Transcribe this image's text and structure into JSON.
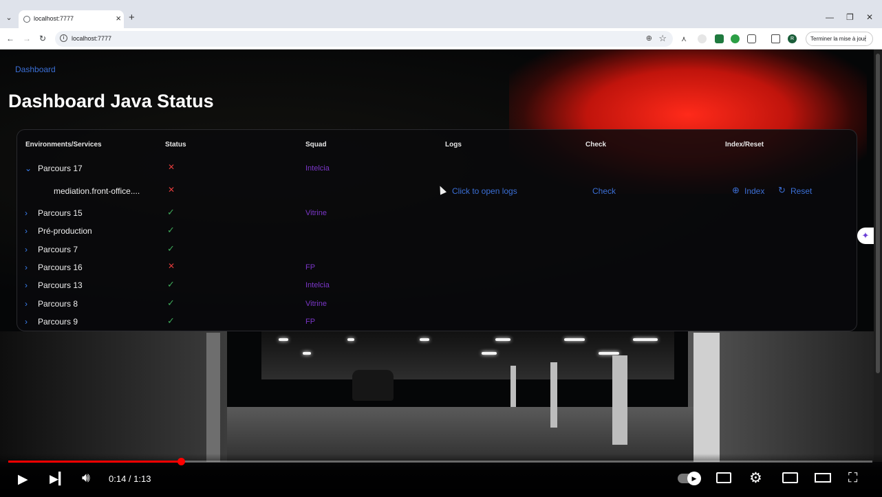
{
  "browser": {
    "tab_title": "localhost:7777",
    "url": "localhost:7777",
    "update_button_label": "Terminer la mise à jour",
    "profile_initial": "R"
  },
  "page": {
    "nav_link": "Dashboard",
    "title": "Dashboard Java Status"
  },
  "table": {
    "columns": [
      "Environments/Services",
      "Status",
      "Squad",
      "Logs",
      "Check",
      "Index/Reset"
    ],
    "rows": [
      {
        "name": "Parcours 17",
        "status": "error",
        "squad": "Intelcia",
        "expanded": true
      },
      {
        "name": "mediation.front-office....",
        "status": "error",
        "squad": "",
        "child": true,
        "logs_label": "Click to open logs",
        "check_label": "Check",
        "index_label": "Index",
        "reset_label": "Reset"
      },
      {
        "name": "Parcours 15",
        "status": "ok",
        "squad": "Vitrine"
      },
      {
        "name": "Pré-production",
        "status": "ok",
        "squad": ""
      },
      {
        "name": "Parcours 7",
        "status": "ok",
        "squad": ""
      },
      {
        "name": "Parcours 16",
        "status": "error",
        "squad": "FP"
      },
      {
        "name": "Parcours 13",
        "status": "ok",
        "squad": "Intelcia"
      },
      {
        "name": "Parcours 8",
        "status": "ok",
        "squad": "Vitrine"
      },
      {
        "name": "Parcours 9",
        "status": "ok",
        "squad": "FP"
      }
    ]
  },
  "video": {
    "time": "0:14 / 1:13",
    "progress": 0.2
  },
  "colors": {
    "status_ok": "#3faa5b",
    "status_error": "#e23b3b",
    "squad": "#7b36c9",
    "link": "#3b6fd6",
    "progress": "#ff0000"
  }
}
